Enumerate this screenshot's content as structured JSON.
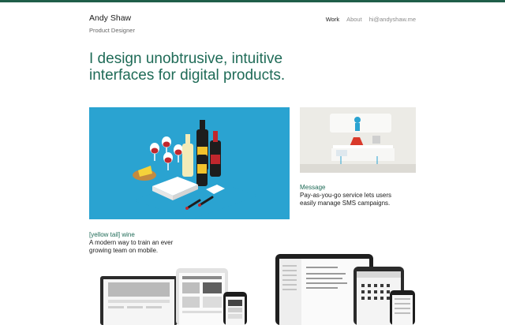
{
  "header": {
    "name": "Andy Shaw",
    "title": "Product Designer",
    "nav": [
      {
        "label": "Work",
        "active": true
      },
      {
        "label": "About",
        "active": false
      },
      {
        "label": "hi@andyshaw.me",
        "active": false
      }
    ]
  },
  "hero": {
    "line1": "I design unobtrusive, intuitive",
    "line2": "interfaces for digital products."
  },
  "projects": {
    "wine": {
      "title": "[yellow tail] wine",
      "desc1": "A modern way to train an ever",
      "desc2": "growing team on mobile."
    },
    "message": {
      "title": "Message",
      "desc1": "Pay-as-you-go service lets users",
      "desc2": "easily manage SMS campaigns."
    }
  },
  "colors": {
    "accent": "#1f6b57",
    "topbar": "#1f5e49",
    "wine_bg": "#2aa3d1"
  }
}
